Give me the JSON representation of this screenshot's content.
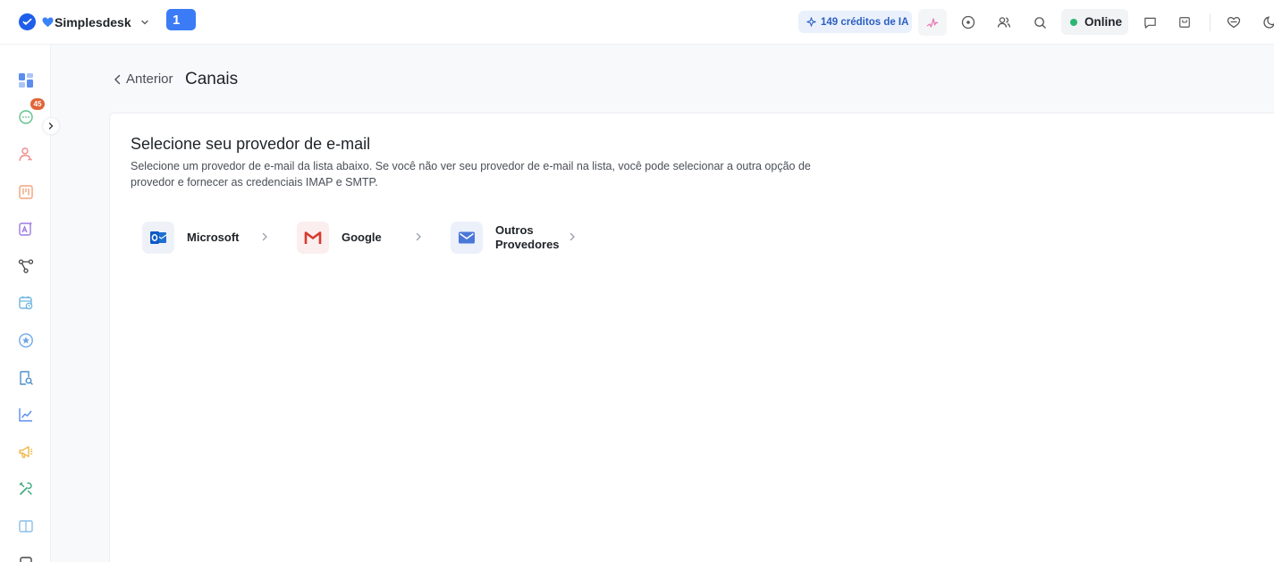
{
  "topbar": {
    "brand_name": "Simplesdesk",
    "app_badge": "1",
    "credits": "149 créditos de IA",
    "status": "Online"
  },
  "sidebar": {
    "conversations_badge": "45",
    "items": [
      "dashboard",
      "conversations",
      "contacts",
      "kanban",
      "ai-assistant",
      "flows",
      "schedule",
      "ratings",
      "reports-search",
      "analytics",
      "campaigns",
      "tools",
      "knowledge-base",
      "more"
    ]
  },
  "header": {
    "back_label": "Anterior",
    "title": "Canais"
  },
  "content": {
    "title": "Selecione seu provedor de e-mail",
    "description": "Selecione um provedor de e-mail da lista abaixo. Se você não ver seu provedor de e-mail na lista, você pode selecionar a outra opção de provedor e fornecer as credenciais IMAP e SMTP.",
    "providers": [
      {
        "label": "Microsoft",
        "icon": "outlook-icon"
      },
      {
        "label": "Google",
        "icon": "gmail-icon"
      },
      {
        "label": "Outros Provedores",
        "icon": "mail-icon"
      }
    ]
  },
  "colors": {
    "accent": "#1f5eea",
    "badge": "#e0653a",
    "online": "#2bb673",
    "credits_bg": "#eaf1fd"
  }
}
